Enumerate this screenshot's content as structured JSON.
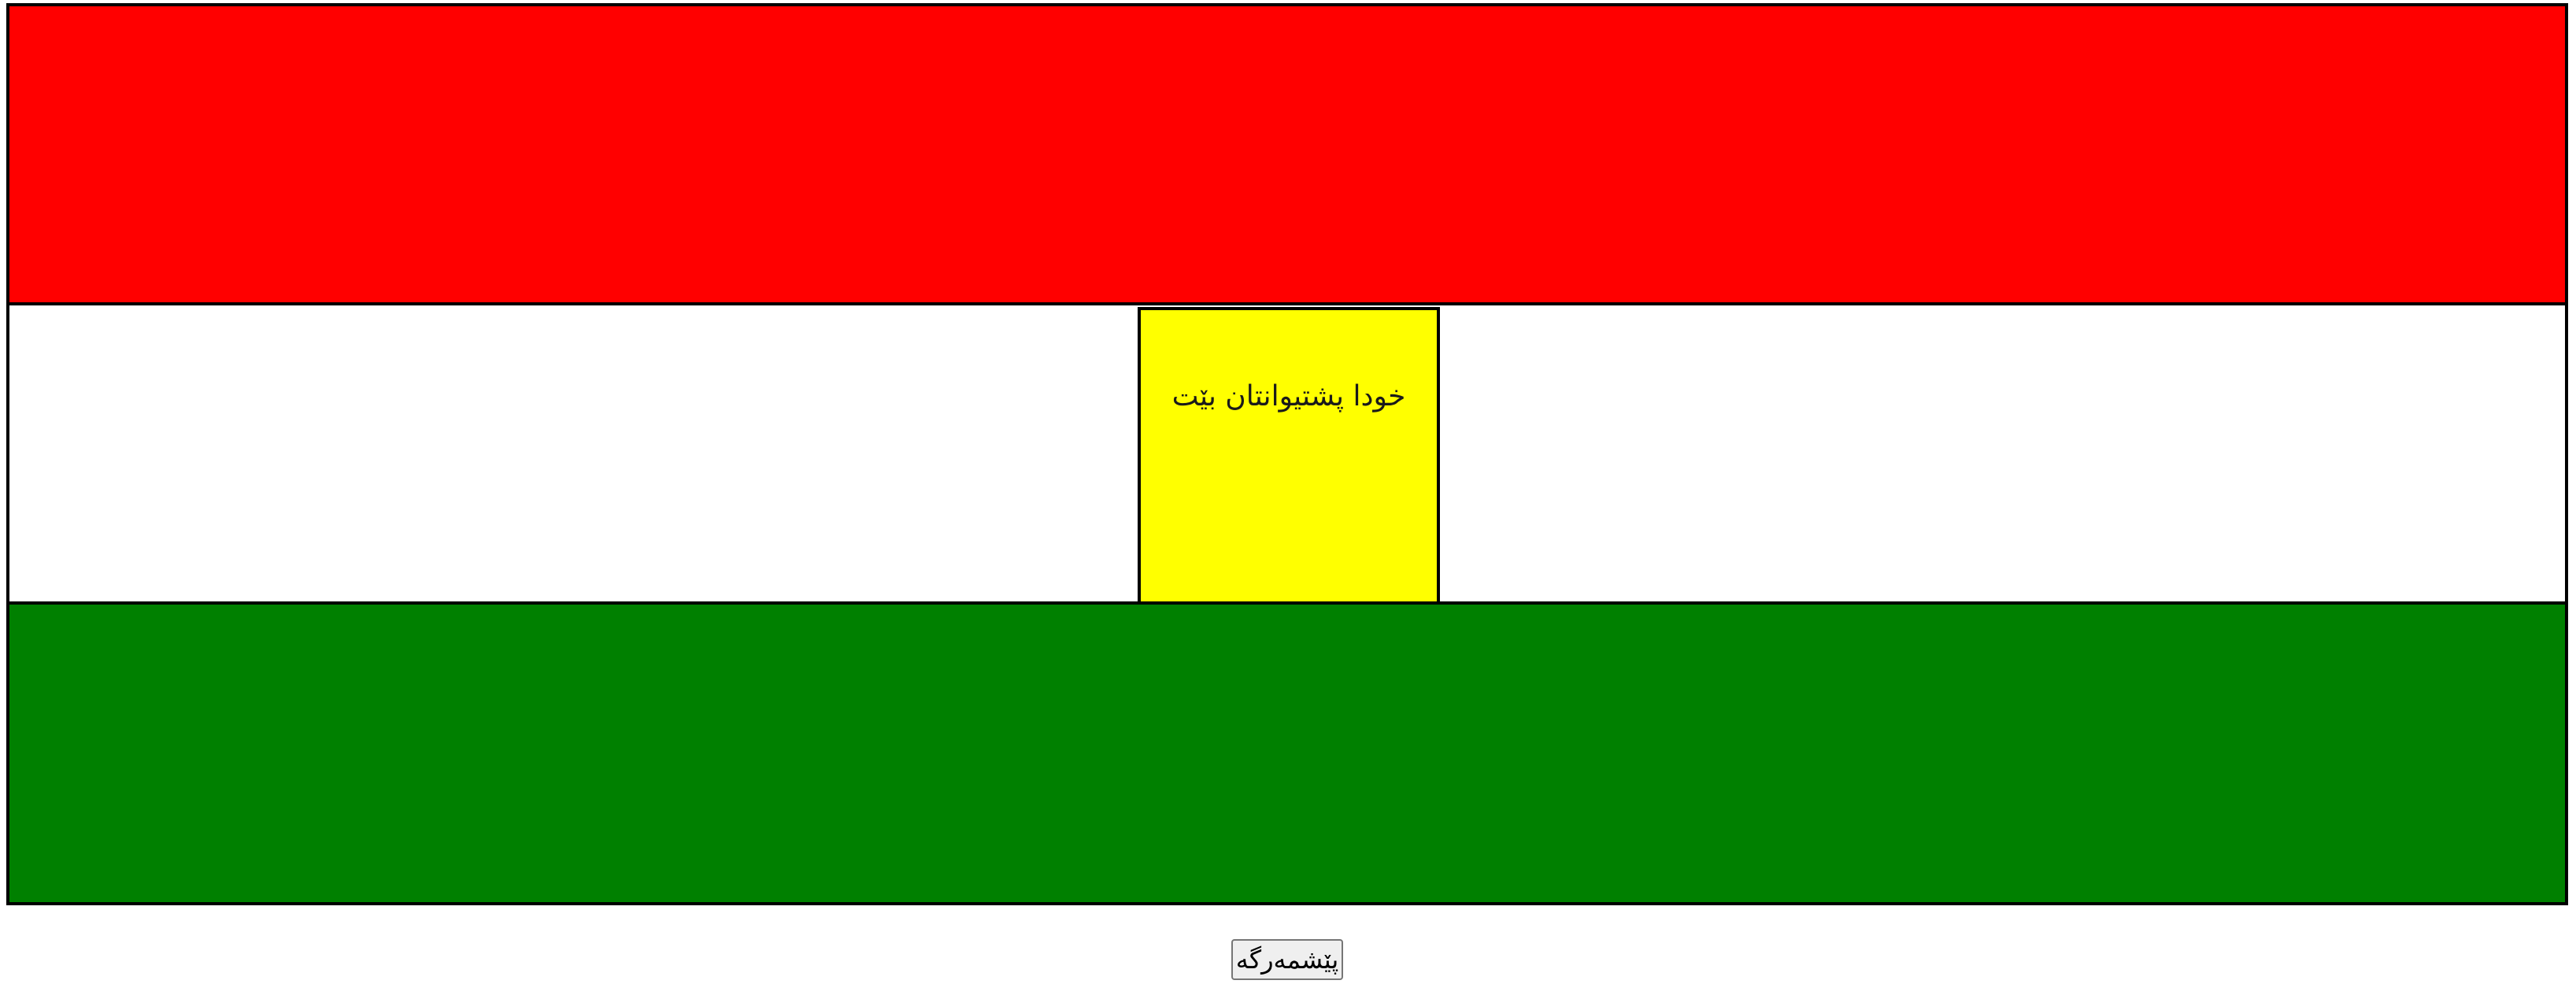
{
  "flag": {
    "colors": {
      "top": "#ff0000",
      "middle": "#ffffff",
      "bottom": "#008000",
      "center": "#ffff00",
      "border": "#000000"
    },
    "center_text": "خودا پشتیوانتان بێت"
  },
  "button": {
    "label": "پێشمەرگە"
  }
}
